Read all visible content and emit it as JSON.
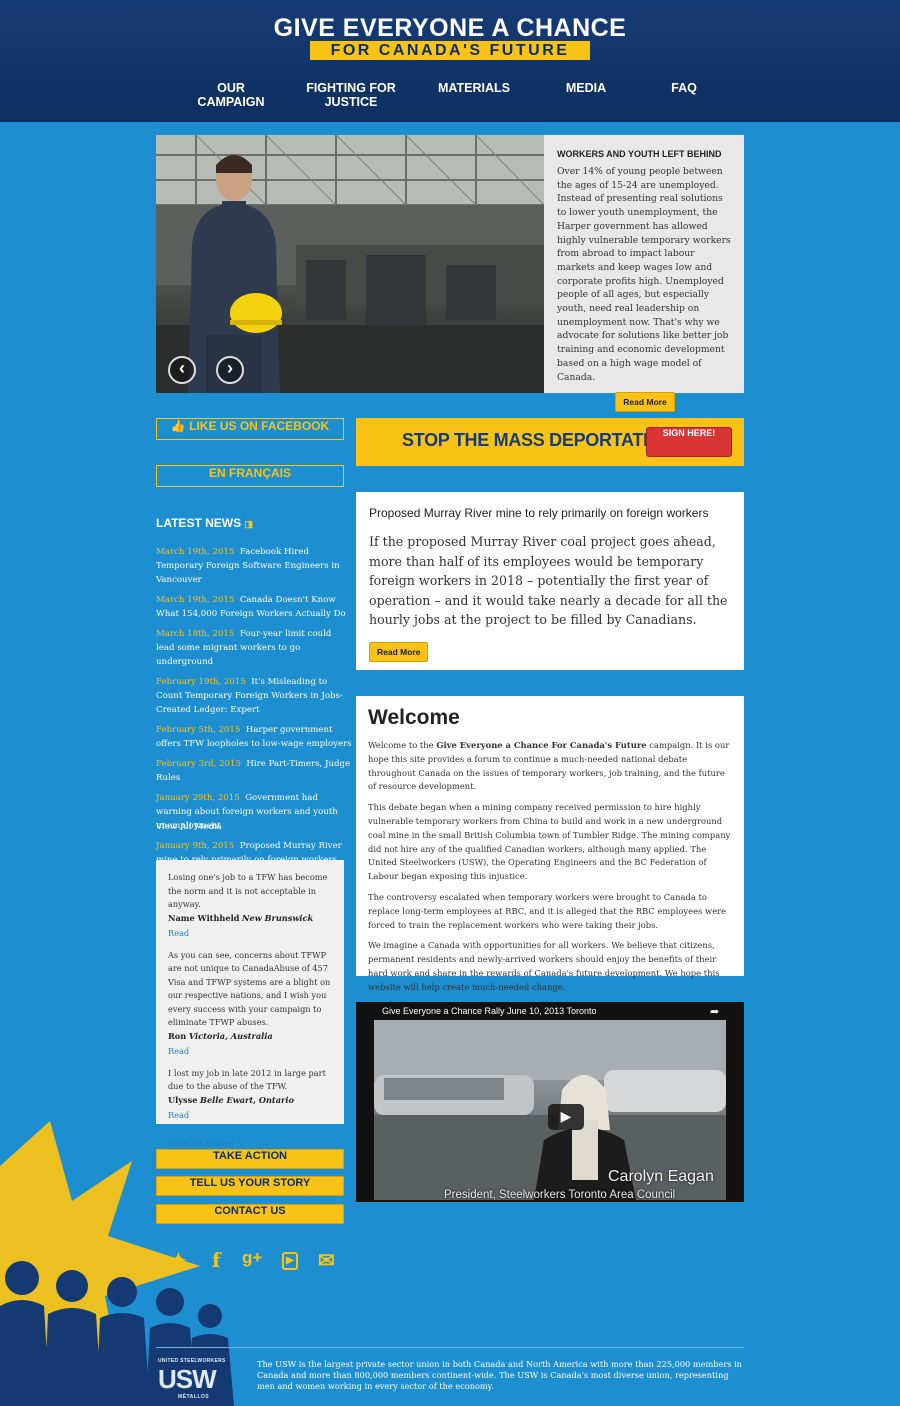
{
  "header": {
    "title_line1": "GIVE EVERYONE A CHANCE",
    "title_line2": "FOR CANADA'S FUTURE",
    "nav": [
      {
        "label": "OUR CAMPAIGN"
      },
      {
        "label": "FIGHTING FOR JUSTICE"
      },
      {
        "label": "MATERIALS"
      },
      {
        "label": "MEDIA"
      },
      {
        "label": "FAQ"
      }
    ]
  },
  "slider": {
    "title": "WORKERS AND YOUTH LEFT BEHIND",
    "body": "Over 14% of young people between the ages of 15-24 are unemployed. Instead of presenting real solutions to lower youth unemployment, the Harper government has allowed highly vulnerable temporary workers from abroad to impact labour markets and keep wages low and corporate profits high. Unemployed people of all ages, but especially youth, need real leadership on unemployment now. That's why we advocate for solutions like better job training and economic development based on a high wage model of Canada.",
    "read_more": "Read More",
    "prev_icon": "chevron-left-icon",
    "next_icon": "chevron-right-icon"
  },
  "sidebar": {
    "facebook_label": "LIKE US ON FACEBOOK",
    "french_label": "EN FRANÇAIS",
    "latest_news_title": "LATEST NEWS",
    "news": [
      {
        "date": "March 19th, 2015",
        "title": "Facebook Hired Temporary Foreign Software Engineers in Vancouver"
      },
      {
        "date": "March 19th, 2015",
        "title": "Canada Doesn't Know What 154,000 Foreign Workers Actually Do"
      },
      {
        "date": "March 18th, 2015",
        "title": "Four-year limit could lead some migrant workers to go underground"
      },
      {
        "date": "February 19th, 2015",
        "title": "It's Misleading to Count Temporary Foreign Workers in Jobs-Created Ledger: Expert"
      },
      {
        "date": "February 5th, 2015",
        "title": "Harper government offers TFW loopholes to low-wage employers"
      },
      {
        "date": "February 3rd, 2015",
        "title": "Hire Part-Timers, Judge Rules"
      },
      {
        "date": "January 29th, 2015",
        "title": "Government had warning about foreign workers and youth unemployment"
      },
      {
        "date": "January 9th, 2015",
        "title": "Proposed Murray River mine to rely primarily on foreign workers"
      }
    ],
    "view_all_media": "View All Media",
    "stories": [
      {
        "text": "Losing one's job to a TFW has become the norm and it is not acceptable in anyway.",
        "author": "Name Withheld",
        "place": "New Brunswick",
        "read": "Read"
      },
      {
        "text": "As you can see, concerns about TFWP are not unique to CanadaAbuse of 457 Visa and TFWP systems are a blight on our respective nations, and I wish you every success with your campaign to eliminate TFWP abuses.",
        "author": "Ron",
        "place": "Victoria, Australia",
        "read": "Read"
      },
      {
        "text": "I lost my job in late 2012 in large part due to the abuse of the TFW.",
        "author": "Ulysse",
        "place": "Belle Ewart, Ontario",
        "read": "Read"
      }
    ],
    "view_all_stories": "View All Stories",
    "take_action": "TAKE ACTION",
    "tell_story": "TELL US YOUR STORY",
    "contact_us": "CONTACT US",
    "social_icons": [
      "twitter-icon",
      "facebook-icon",
      "google-plus-icon",
      "youtube-icon",
      "email-icon"
    ]
  },
  "deportation": {
    "text": "STOP THE MASS DEPORTATION!",
    "button": "SIGN HERE!"
  },
  "feature": {
    "title": "Proposed Murray River mine to rely primarily on foreign workers",
    "body": "If the proposed Murray River coal project goes ahead, more than half of its employees would be temporary foreign workers in 2018 – potentially the first year of operation – and it would take nearly a decade for all the hourly jobs at the project to be filled by Canadians.",
    "read_more": "Read More"
  },
  "welcome": {
    "title": "Welcome",
    "p1_before": "Welcome to the ",
    "p1_bold": "Give Everyone a Chance For Canada's Future",
    "p1_after": " campaign. It is our hope this site provides a forum to continue a much-needed national debate throughout Canada on the issues of temporary workers, job training, and the future of resource development.",
    "p2": "This debate began when a mining company received permission to hire highly vulnerable temporary workers from China to build and work in a new underground coal mine in the small British Columbia town of Tumbler Ridge. The mining company did not hire any of the qualified Canadian workers, although many applied. The United Steelworkers (USW), the Operating Engineers and the BC Federation of Labour began exposing this injustice.",
    "p3": "The controversy escalated when temporary workers were brought to Canada to replace long-term employees at RBC, and it is alleged that the RBC employees were forced to train the replacement workers who were taking their jobs.",
    "p4": "We imagine a Canada with opportunities for all workers. We believe that citizens, permanent residents and newly-arrived workers should enjoy the benefits of their hard work and share in the rewards of Canada's future development. We hope this website will help create much-needed change."
  },
  "video": {
    "title": "Give Everyone a Chance Rally June 10, 2013 Toronto",
    "speaker_name": "Carolyn Eagan",
    "speaker_role": "President, Steelworkers Toronto Area Council",
    "play_icon": "play-icon",
    "share_icon": "share-icon"
  },
  "footer": {
    "org_small": "UNITED STEELWORKERS",
    "logo": "USW",
    "metallos": "MÉTALLOS",
    "text": "The USW is the largest private sector union in both Canada and North America with more than 225,000 members in Canada and more than 800,000 members continent-wide. The USW is Canada's most diverse union, representing men and women working in every sector of the economy."
  },
  "colors": {
    "background": "#1d8ed0",
    "header": "#0d2f60",
    "accent_yellow": "#f8c316",
    "sign_red": "#d93535"
  }
}
